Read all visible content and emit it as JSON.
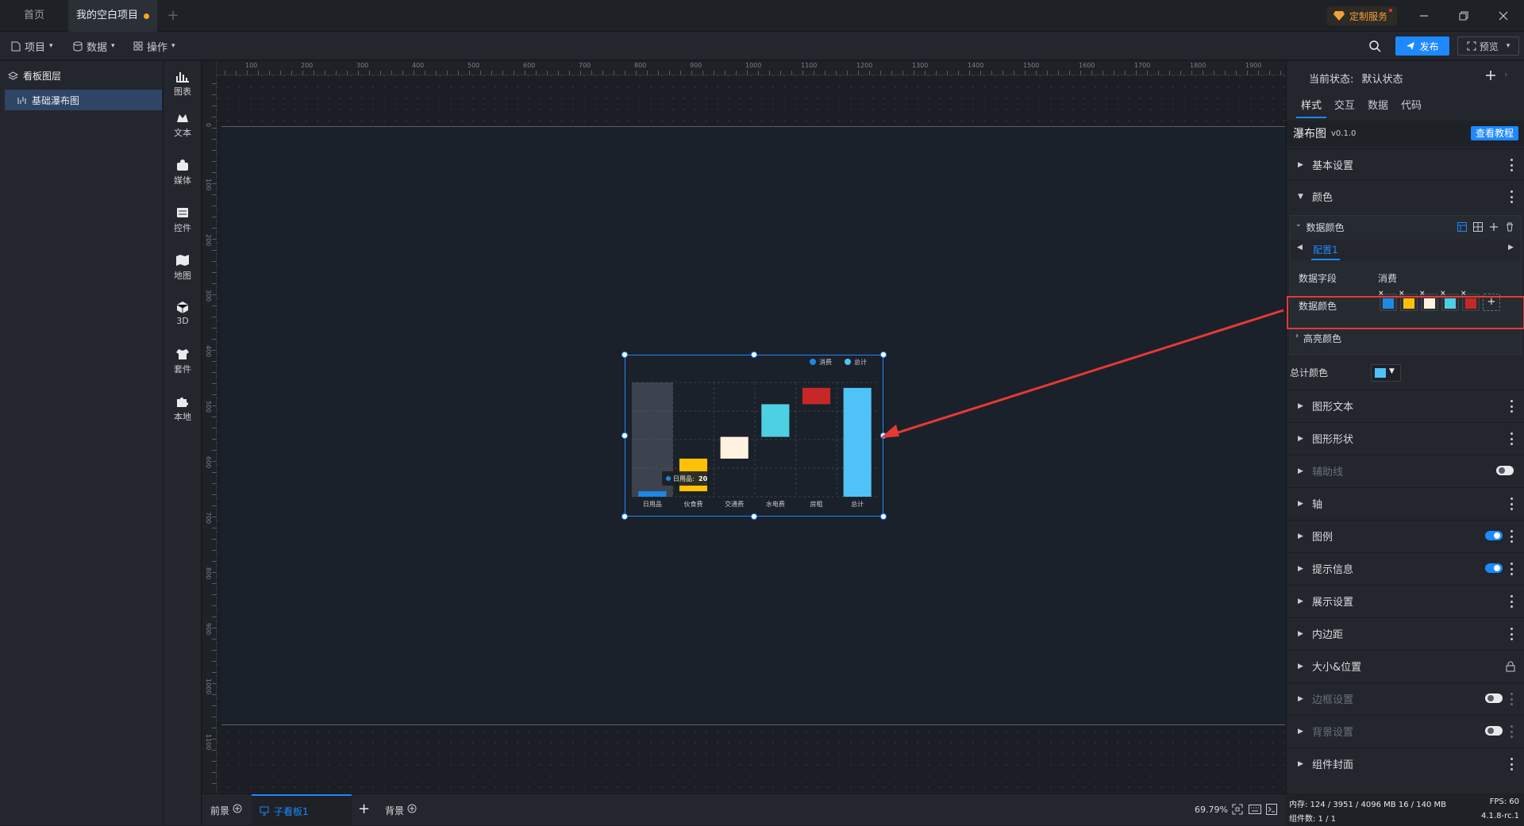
{
  "titlebar": {
    "tabs": [
      {
        "label": "首页"
      },
      {
        "label": "我的空白项目"
      }
    ],
    "service_label": "定制服务"
  },
  "menubar": {
    "project": "项目",
    "data": "数据",
    "operate": "操作",
    "publish": "发布",
    "preview": "预览"
  },
  "layers": {
    "title": "看板图层",
    "items": [
      {
        "label": "基础瀑布图"
      }
    ]
  },
  "toolrail": {
    "items": [
      {
        "label": "图表",
        "icon": "bar-chart-icon"
      },
      {
        "label": "文本",
        "icon": "text-icon"
      },
      {
        "label": "媒体",
        "icon": "media-icon"
      },
      {
        "label": "控件",
        "icon": "widget-icon"
      },
      {
        "label": "地图",
        "icon": "map-icon"
      },
      {
        "label": "3D",
        "icon": "cube-icon"
      },
      {
        "label": "套件",
        "icon": "kit-icon"
      },
      {
        "label": "本地",
        "icon": "puzzle-icon"
      }
    ]
  },
  "ruler": {
    "h_ticks": [
      "100",
      "200",
      "300",
      "400",
      "500",
      "600",
      "700",
      "800",
      "900",
      "1000",
      "1100",
      "1200",
      "1300",
      "1400",
      "1500",
      "1600",
      "1700",
      "1800",
      "1900"
    ],
    "v_ticks": [
      "0",
      "100",
      "200",
      "300",
      "400",
      "500",
      "600",
      "700",
      "800",
      "900",
      "1000",
      "1100"
    ]
  },
  "chart_data": {
    "type": "bar",
    "subtype": "waterfall",
    "categories": [
      "日用品",
      "伙食费",
      "交通费",
      "水电费",
      "房租",
      "总计"
    ],
    "series": [
      {
        "name": "消费",
        "values": [
          20,
          120,
          80,
          120,
          60,
          400
        ]
      },
      {
        "name": "总计",
        "values": [
          400
        ]
      }
    ],
    "legend": [
      "消费",
      "总计"
    ],
    "legend_position": "top-right",
    "colors": [
      "#1e88e5",
      "#ffc107",
      "#fff3e0",
      "#4dd0e1",
      "#c62828",
      "#4fc3f7"
    ],
    "ylim": [
      0,
      420
    ],
    "tooltip": {
      "label": "日用品:",
      "value": "20"
    },
    "grid": true
  },
  "rightpanel": {
    "state_label": "当前状态:",
    "state_value": "默认状态",
    "tabs": [
      "样式",
      "交互",
      "数据",
      "代码"
    ],
    "component_name": "瀑布图",
    "version": "v0.1.0",
    "tutorial": "查看教程",
    "sections": {
      "basic": "基本设置",
      "color": "颜色",
      "data_color_group": "数据颜色",
      "config_tab": "配置1",
      "data_field_label": "数据字段",
      "data_field_value": "消费",
      "data_color_label": "数据颜色",
      "highlight": "高亮颜色",
      "total_color": "总计颜色",
      "graph_text": "图形文本",
      "graph_shape": "图形形状",
      "guide_line": "辅助线",
      "axis": "轴",
      "legend": "图例",
      "tooltip": "提示信息",
      "display": "展示设置",
      "padding": "内边距",
      "size_pos": "大小&位置",
      "border": "边框设置",
      "background": "背景设置",
      "cover": "组件封面"
    },
    "swatch_colors": [
      "#1e88e5",
      "#ffc107",
      "#fff3e0",
      "#4dd0e1",
      "#c62828"
    ],
    "total_color_value": "#4fc3f7",
    "annotation_color": "#e53935"
  },
  "statusbar": {
    "front": "前景",
    "sub_board": "子看板1",
    "background": "背景",
    "zoom": "69.79%"
  },
  "rstatus": {
    "memory": "内存: 124 / 3951 / 4096 MB 16 / 140 MB",
    "fps": "FPS: 60",
    "components": "组件数: 1 / 1",
    "version": "4.1.8-rc.1"
  }
}
